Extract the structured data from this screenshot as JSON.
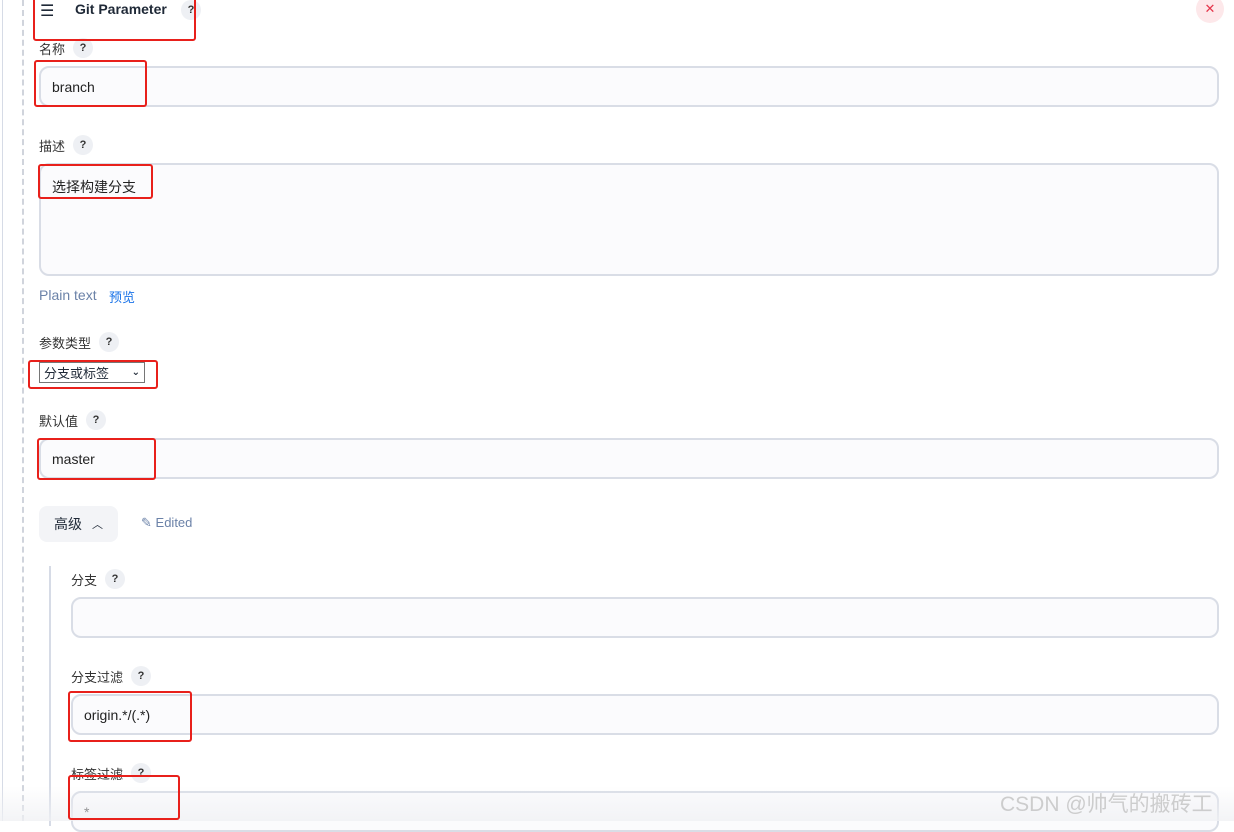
{
  "header": {
    "title": "Git Parameter",
    "help": "?",
    "menu_icon": "hamburger-icon",
    "close_icon": "close-icon"
  },
  "name": {
    "label": "名称",
    "help": "?",
    "value": "branch"
  },
  "description": {
    "label": "描述",
    "help": "?",
    "value": "选择构建分支",
    "format_plain": "Plain text",
    "format_preview": "预览"
  },
  "param_type": {
    "label": "参数类型",
    "help": "?",
    "selected": "分支或标签"
  },
  "default_value": {
    "label": "默认值",
    "help": "?",
    "value": "master"
  },
  "advanced": {
    "label": "高级",
    "edited": "Edited"
  },
  "branch": {
    "label": "分支",
    "help": "?",
    "value": ""
  },
  "branch_filter": {
    "label": "分支过滤",
    "help": "?",
    "value": "origin.*/(.*)"
  },
  "tag_filter": {
    "label": "标签过滤",
    "help": "?",
    "value": "*"
  },
  "watermark": "CSDN @帅气的搬砖工",
  "colors": {
    "annotation": "#e8201b",
    "link": "#1a73e8",
    "muted_link": "#6b82a8"
  }
}
